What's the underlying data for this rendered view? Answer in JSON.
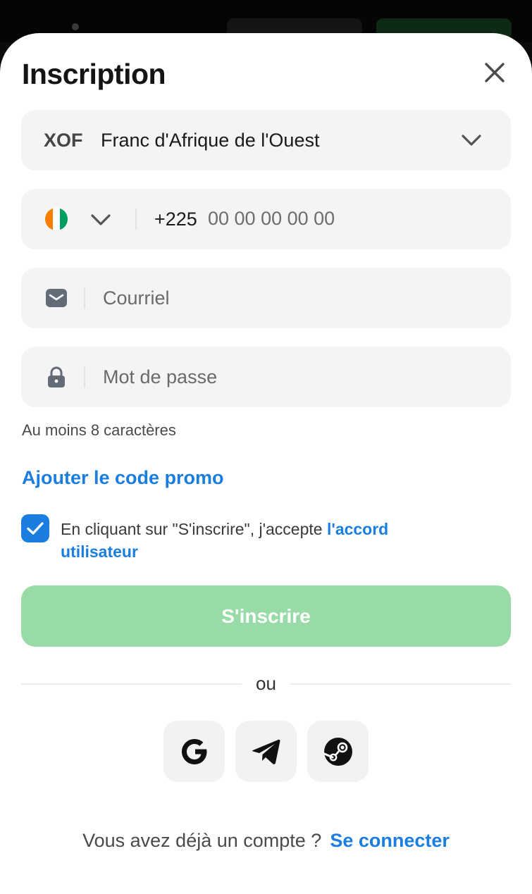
{
  "sheet": {
    "title": "Inscription",
    "close_icon": "close-icon"
  },
  "currency": {
    "code": "XOF",
    "name": "Franc d'Afrique de l'Ouest",
    "dropdown_icon": "chevron-down-icon"
  },
  "phone": {
    "country_flag": "cote-divoire-flag-icon",
    "flag_colors": [
      "#f77f00",
      "#ffffff",
      "#009e60"
    ],
    "prefix": "+225",
    "placeholder": "00 00 00 00 00"
  },
  "email": {
    "icon": "envelope-icon",
    "placeholder": "Courriel"
  },
  "password": {
    "icon": "lock-icon",
    "placeholder": "Mot de passe",
    "hint": "Au moins 8 caractères"
  },
  "promo": {
    "label": "Ajouter le code promo"
  },
  "terms": {
    "checked": true,
    "text": "En cliquant sur \"S'inscrire\", j'accepte ",
    "link": "l'accord utilisateur"
  },
  "submit": {
    "label": "S'inscrire"
  },
  "divider": {
    "label": "ou"
  },
  "social": [
    "google-icon",
    "telegram-icon",
    "steam-icon"
  ],
  "footer": {
    "question": "Vous avez déjà un compte ?",
    "link": "Se connecter"
  },
  "colors": {
    "accent": "#1a7ee0",
    "submit_disabled": "#99dba6",
    "field_bg": "#f4f4f4"
  }
}
